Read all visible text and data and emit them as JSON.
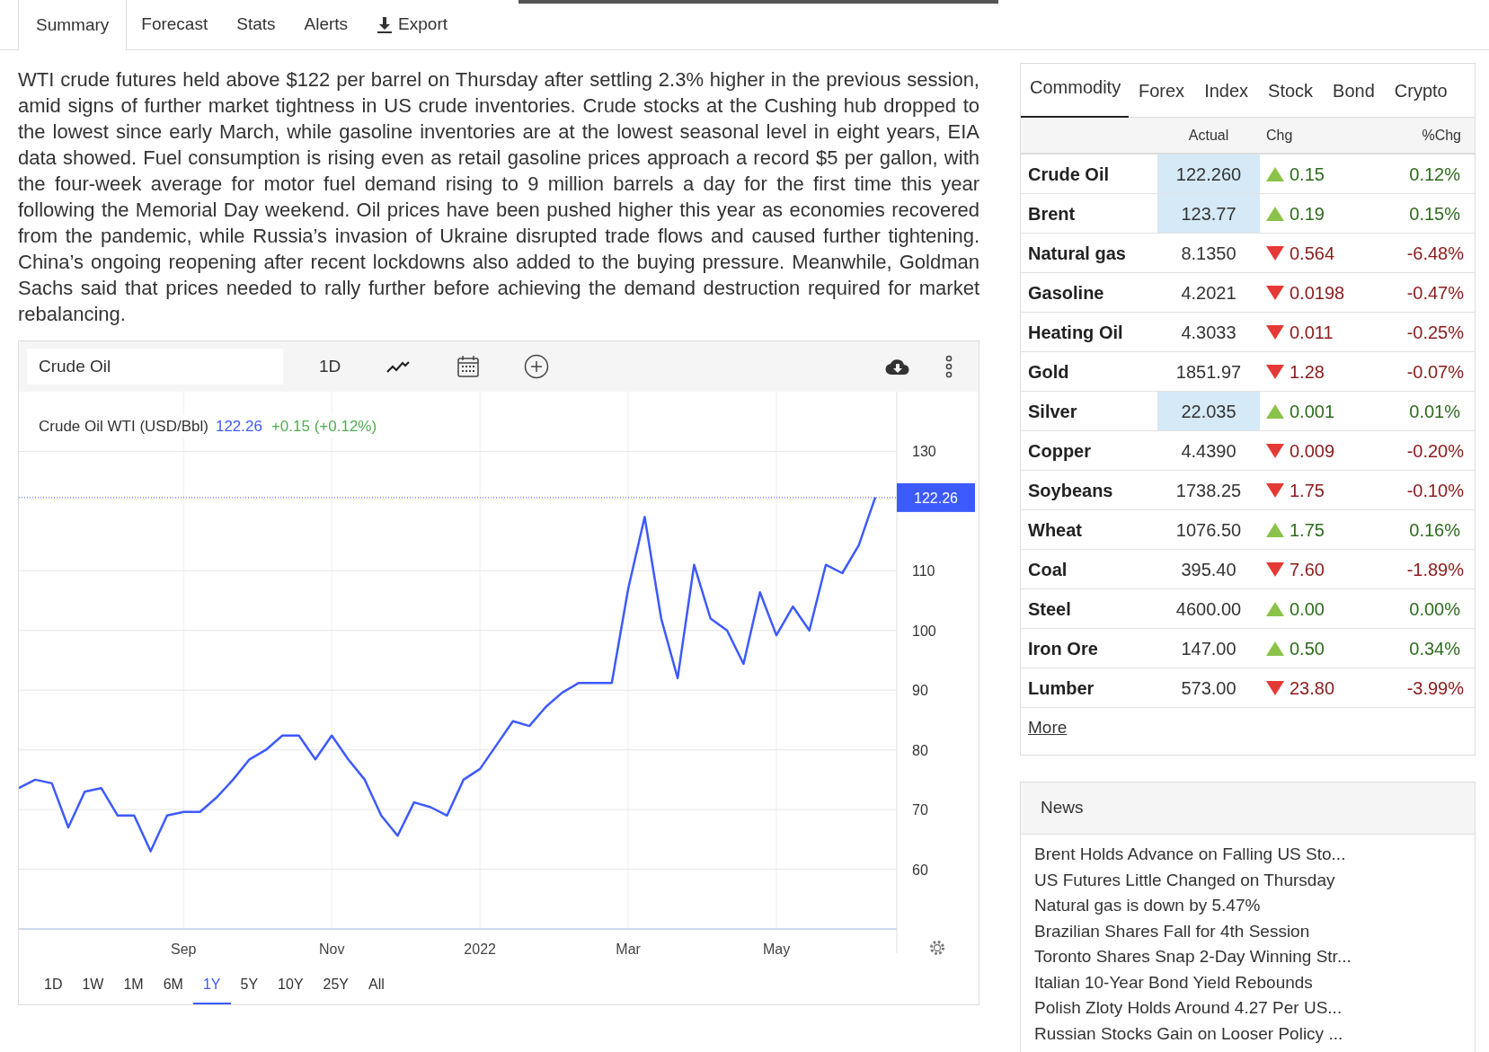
{
  "tabs": [
    {
      "label": "Summary",
      "selected": true,
      "kind": "tab"
    },
    {
      "label": "Forecast",
      "selected": false,
      "kind": "tab"
    },
    {
      "label": "Stats",
      "selected": false,
      "kind": "tab"
    },
    {
      "label": "Alerts",
      "selected": false,
      "kind": "tab"
    },
    {
      "label": "Export",
      "selected": false,
      "kind": "export"
    }
  ],
  "summary": "WTI crude futures held above $122 per barrel on Thursday after settling 2.3% higher in the previous session, amid signs of further market tightness in US crude inventories. Crude stocks at the Cushing hub dropped to the lowest since early March, while gasoline inventories are at the lowest seasonal level in eight years, EIA data showed. Fuel consumption is rising even as retail gasoline prices approach a record $5 per gallon, with the four-week average for motor fuel demand rising to 9 million barrels a day for the first time this year following the Memorial Day weekend. Oil prices have been pushed higher this year as economies recovered from the pandemic, while Russia’s invasion of Ukraine disrupted trade flows and caused further tightening. China’s ongoing reopening after recent lockdowns also added to the buying pressure. Meanwhile, Goldman Sachs said that prices needed to rally further before achieving the demand destruction required for market rebalancing.",
  "chart_panel": {
    "symbol": "Crude Oil",
    "interval": "1D",
    "legend": {
      "name": "Crude Oil WTI (USD/Bbl)",
      "price": "122.26",
      "change": "+0.15 (+0.12%)"
    },
    "chart_data": {
      "type": "line",
      "categories": [
        null,
        null,
        null,
        null,
        null,
        null,
        null,
        null,
        null,
        null,
        "Sep",
        null,
        null,
        null,
        null,
        null,
        null,
        null,
        null,
        "Nov",
        null,
        null,
        null,
        null,
        null,
        null,
        null,
        null,
        "2022",
        null,
        null,
        null,
        null,
        null,
        null,
        null,
        null,
        "Mar",
        null,
        null,
        null,
        null,
        null,
        null,
        null,
        null,
        "May",
        null,
        null,
        null,
        null,
        null,
        null
      ],
      "series": [
        {
          "color": "#3d5afe",
          "values": [
            73.6,
            75,
            74.4,
            67,
            73,
            73.6,
            69,
            69,
            63,
            69,
            69.6,
            69.6,
            72,
            75,
            78.4,
            80,
            82.4,
            82.4,
            78.4,
            82.4,
            78.4,
            75,
            69,
            65.6,
            71.2,
            70.4,
            69,
            75,
            76.8,
            80.8,
            84.8,
            84,
            87.2,
            89.6,
            91.2,
            91.2,
            91.2,
            107,
            119,
            102,
            92,
            111,
            102,
            100,
            94.4,
            106.4,
            99.2,
            104,
            100,
            111,
            109.6,
            114.3,
            122.3
          ]
        }
      ],
      "ylim": [
        50,
        140
      ],
      "grid": true,
      "ref_lines": [
        {
          "axis": "y",
          "value": 122.26,
          "label": "122.26"
        }
      ],
      "yticks": [
        60,
        70,
        80,
        90,
        100,
        110,
        130
      ]
    },
    "ranges": [
      {
        "label": "1D",
        "selected": false
      },
      {
        "label": "1W",
        "selected": false
      },
      {
        "label": "1M",
        "selected": false
      },
      {
        "label": "6M",
        "selected": false
      },
      {
        "label": "1Y",
        "selected": true
      },
      {
        "label": "5Y",
        "selected": false
      },
      {
        "label": "10Y",
        "selected": false
      },
      {
        "label": "25Y",
        "selected": false
      },
      {
        "label": "All",
        "selected": false
      }
    ]
  },
  "markets": {
    "tabs": [
      {
        "label": "Commodity",
        "selected": true
      },
      {
        "label": "Forex",
        "selected": false
      },
      {
        "label": "Index",
        "selected": false
      },
      {
        "label": "Stock",
        "selected": false
      },
      {
        "label": "Bond",
        "selected": false
      },
      {
        "label": "Crypto",
        "selected": false
      }
    ],
    "columns": [
      "Actual",
      "Chg",
      "%Chg"
    ],
    "rows": [
      {
        "name": "Crude Oil",
        "actual": "122.260",
        "highlighted": true,
        "up": true,
        "chg": "0.15",
        "pct": "0.12%"
      },
      {
        "name": "Brent",
        "actual": "123.77",
        "highlighted": true,
        "up": true,
        "chg": "0.19",
        "pct": "0.15%"
      },
      {
        "name": "Natural gas",
        "actual": "8.1350",
        "highlighted": false,
        "up": false,
        "chg": "0.564",
        "pct": "-6.48%"
      },
      {
        "name": "Gasoline",
        "actual": "4.2021",
        "highlighted": false,
        "up": false,
        "chg": "0.0198",
        "pct": "-0.47%"
      },
      {
        "name": "Heating Oil",
        "actual": "4.3033",
        "highlighted": false,
        "up": false,
        "chg": "0.011",
        "pct": "-0.25%"
      },
      {
        "name": "Gold",
        "actual": "1851.97",
        "highlighted": false,
        "up": false,
        "chg": "1.28",
        "pct": "-0.07%"
      },
      {
        "name": "Silver",
        "actual": "22.035",
        "highlighted": true,
        "up": true,
        "chg": "0.001",
        "pct": "0.01%"
      },
      {
        "name": "Copper",
        "actual": "4.4390",
        "highlighted": false,
        "up": false,
        "chg": "0.009",
        "pct": "-0.20%"
      },
      {
        "name": "Soybeans",
        "actual": "1738.25",
        "highlighted": false,
        "up": false,
        "chg": "1.75",
        "pct": "-0.10%"
      },
      {
        "name": "Wheat",
        "actual": "1076.50",
        "highlighted": false,
        "up": true,
        "chg": "1.75",
        "pct": "0.16%"
      },
      {
        "name": "Coal",
        "actual": "395.40",
        "highlighted": false,
        "up": false,
        "chg": "7.60",
        "pct": "-1.89%"
      },
      {
        "name": "Steel",
        "actual": "4600.00",
        "highlighted": false,
        "up": true,
        "chg": "0.00",
        "pct": "0.00%"
      },
      {
        "name": "Iron Ore",
        "actual": "147.00",
        "highlighted": false,
        "up": true,
        "chg": "0.50",
        "pct": "0.34%"
      },
      {
        "name": "Lumber",
        "actual": "573.00",
        "highlighted": false,
        "up": false,
        "chg": "23.80",
        "pct": "-3.99%"
      }
    ],
    "more_link": "More"
  },
  "news": {
    "title": "News",
    "items": [
      "Brent Holds Advance on Falling US Sto...",
      "US Futures Little Changed on Thursday",
      "Natural gas is down by 5.47%",
      "Brazilian Shares Fall for 4th Session",
      "Toronto Shares Snap 2-Day Winning Str...",
      "Italian 10-Year Bond Yield Rebounds",
      "Polish Zloty Holds Around 4.27 Per US...",
      "Russian Stocks Gain on Looser Policy ..."
    ]
  }
}
